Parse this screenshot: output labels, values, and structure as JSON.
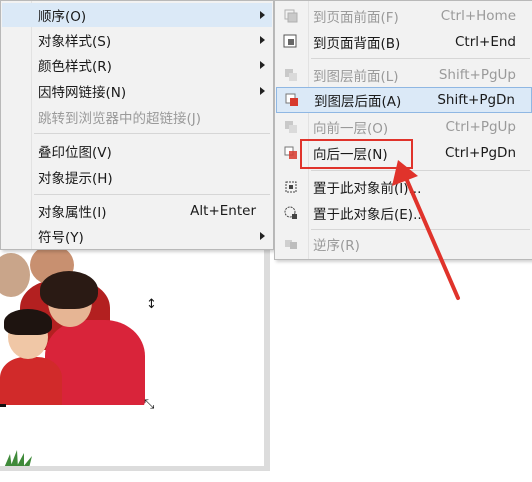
{
  "left_menu": {
    "items": [
      {
        "label": "顺序(O)",
        "shortcut": "",
        "submenu": true,
        "disabled": false,
        "highlighted": true
      },
      {
        "label": "对象样式(S)",
        "shortcut": "",
        "submenu": true,
        "disabled": false
      },
      {
        "label": "颜色样式(R)",
        "shortcut": "",
        "submenu": true,
        "disabled": false
      },
      {
        "label": "因特网链接(N)",
        "shortcut": "",
        "submenu": true,
        "disabled": false
      },
      {
        "label": "跳转到浏览器中的超链接(J)",
        "shortcut": "",
        "submenu": false,
        "disabled": true
      },
      {
        "label": "叠印位图(V)",
        "shortcut": "",
        "submenu": false,
        "disabled": false
      },
      {
        "label": "对象提示(H)",
        "shortcut": "",
        "submenu": false,
        "disabled": false
      },
      {
        "label": "对象属性(I)",
        "shortcut": "Alt+Enter",
        "submenu": false,
        "disabled": false
      },
      {
        "label": "符号(Y)",
        "shortcut": "",
        "submenu": true,
        "disabled": false
      }
    ]
  },
  "right_menu": {
    "items": [
      {
        "label": "到页面前面(F)",
        "shortcut": "Ctrl+Home",
        "disabled": true,
        "icon": "to-page-front-icon"
      },
      {
        "label": "到页面背面(B)",
        "shortcut": "Ctrl+End",
        "disabled": false,
        "icon": "to-page-back-icon"
      },
      {
        "label": "到图层前面(L)",
        "shortcut": "Shift+PgUp",
        "disabled": true,
        "icon": "to-layer-front-icon"
      },
      {
        "label": "到图层后面(A)",
        "shortcut": "Shift+PgDn",
        "disabled": false,
        "highlighted": true,
        "icon": "to-layer-back-icon"
      },
      {
        "label": "向前一层(O)",
        "shortcut": "Ctrl+PgUp",
        "disabled": true,
        "icon": "forward-one-icon"
      },
      {
        "label": "向后一层(N)",
        "shortcut": "Ctrl+PgDn",
        "disabled": false,
        "icon": "back-one-icon"
      },
      {
        "label": "置于此对象前(I)...",
        "shortcut": "",
        "disabled": false,
        "icon": "in-front-of-icon"
      },
      {
        "label": "置于此对象后(E)...",
        "shortcut": "",
        "disabled": false,
        "icon": "behind-icon"
      },
      {
        "label": "逆序(R)",
        "shortcut": "",
        "disabled": true,
        "icon": "reverse-order-icon"
      }
    ]
  },
  "colors": {
    "highlight_bg": "#dbe9f7",
    "highlight_border": "#8fb7e3",
    "annotation_red": "#e0332b"
  }
}
